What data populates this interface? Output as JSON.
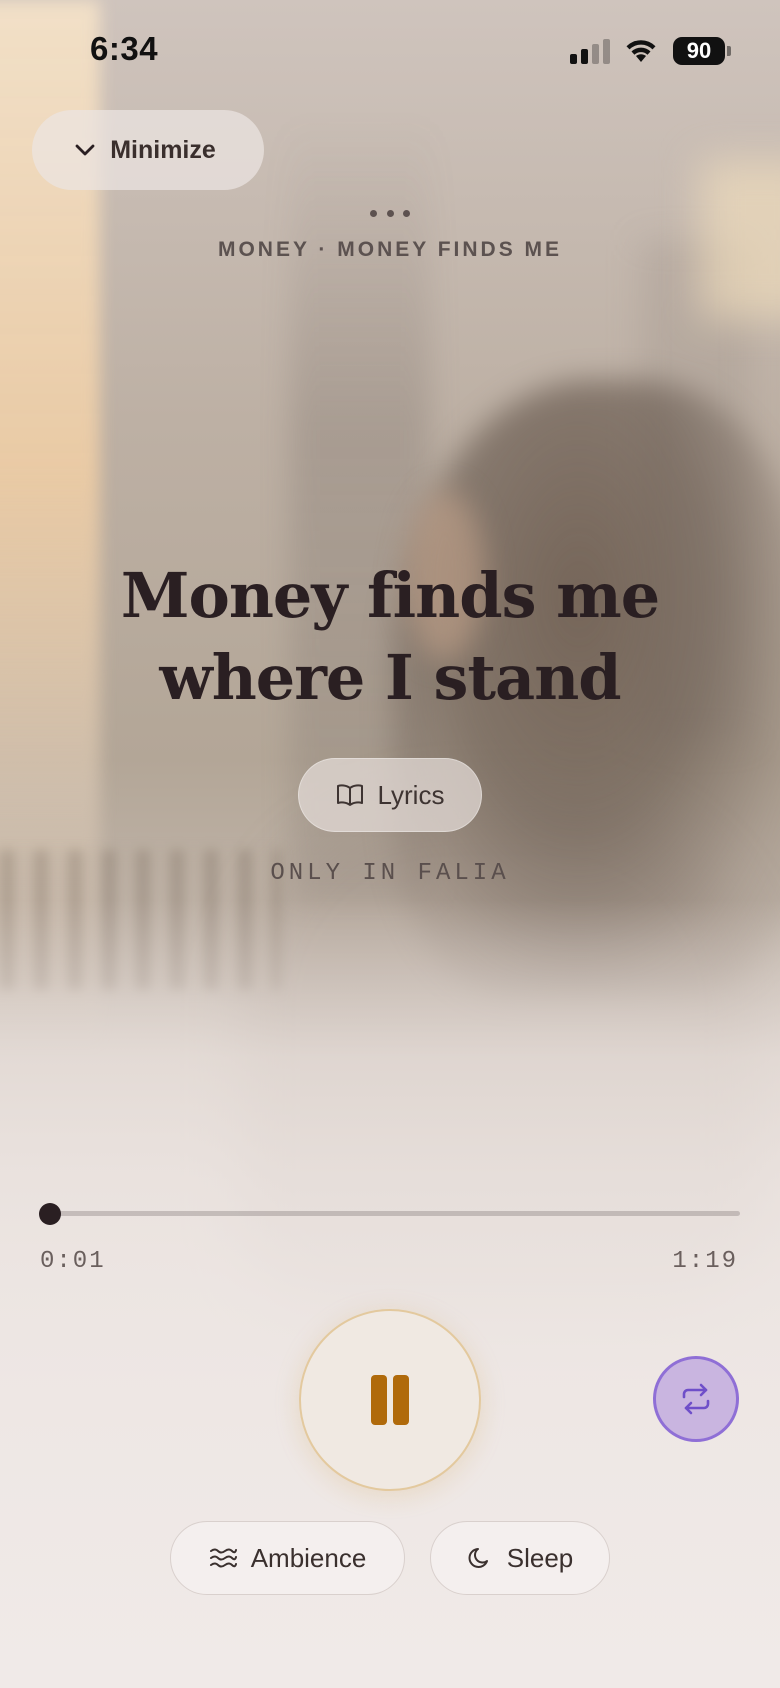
{
  "status_bar": {
    "time": "6:34",
    "battery_level": "90",
    "signal_bars": 2
  },
  "header": {
    "minimize_label": "Minimize",
    "context_label": "MONEY · MONEY FINDS ME"
  },
  "track": {
    "title": "Money finds me where I stand",
    "lyrics_label": "Lyrics",
    "exclusive_label": "ONLY IN FALIA"
  },
  "player": {
    "elapsed": "0:01",
    "total": "1:19",
    "progress_fraction": 0.013,
    "state": "playing",
    "repeat_enabled": true
  },
  "footer": {
    "ambience_label": "Ambience",
    "sleep_label": "Sleep"
  },
  "colors": {
    "accent_pause": "#b06a0b",
    "repeat_bg": "#c9b5e0",
    "repeat_border": "#8f6fd6",
    "title_text": "#2a1f22"
  },
  "icons": {
    "minimize": "chevron-down-icon",
    "lyrics": "open-book-icon",
    "pause": "pause-icon",
    "repeat": "repeat-icon",
    "ambience": "waves-icon",
    "sleep": "moon-icon"
  }
}
